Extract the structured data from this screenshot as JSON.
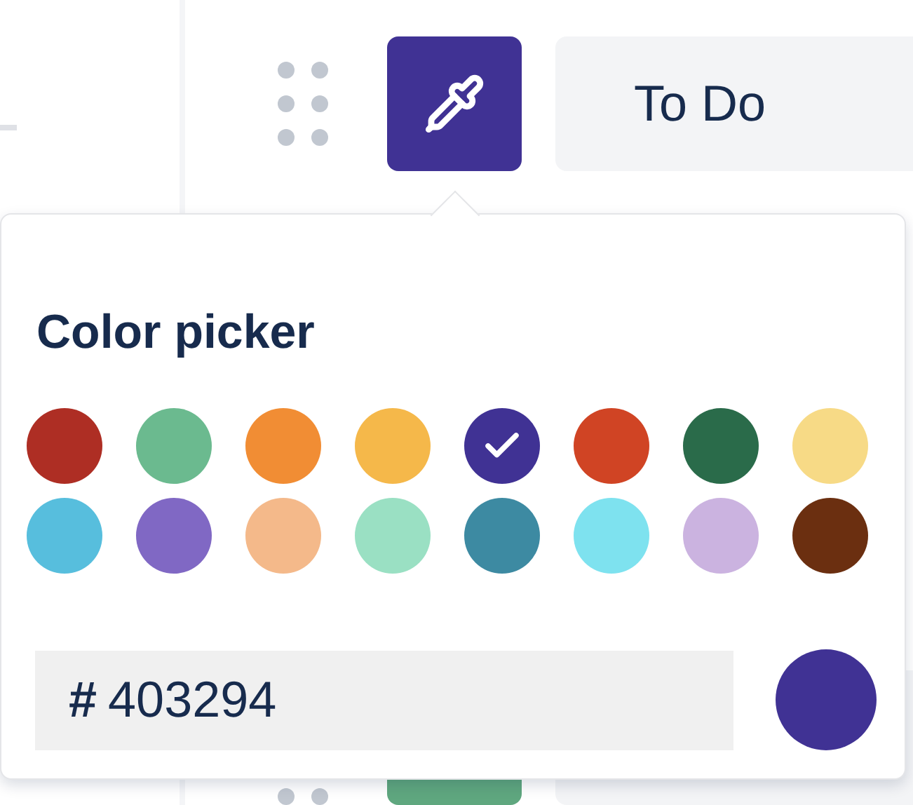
{
  "statuses": [
    {
      "label": "To Do",
      "color": "#403294"
    },
    {
      "color": "#5fa77f"
    }
  ],
  "color_picker": {
    "title": "Color picker",
    "swatches": [
      {
        "color": "#ae2e24",
        "selected": false
      },
      {
        "color": "#6bba8f",
        "selected": false
      },
      {
        "color": "#f18d34",
        "selected": false
      },
      {
        "color": "#f5b84a",
        "selected": false
      },
      {
        "color": "#403294",
        "selected": true
      },
      {
        "color": "#d04424",
        "selected": false
      },
      {
        "color": "#2a6b4a",
        "selected": false
      },
      {
        "color": "#f7da86",
        "selected": false
      },
      {
        "color": "#57bedd",
        "selected": false
      },
      {
        "color": "#8068c4",
        "selected": false
      },
      {
        "color": "#f4b98a",
        "selected": false
      },
      {
        "color": "#9ae0c3",
        "selected": false
      },
      {
        "color": "#3d8aa2",
        "selected": false
      },
      {
        "color": "#7ee2ef",
        "selected": false
      },
      {
        "color": "#cbb3e0",
        "selected": false
      },
      {
        "color": "#6b2f10",
        "selected": false
      }
    ],
    "prefix": "#",
    "value": "403294"
  }
}
